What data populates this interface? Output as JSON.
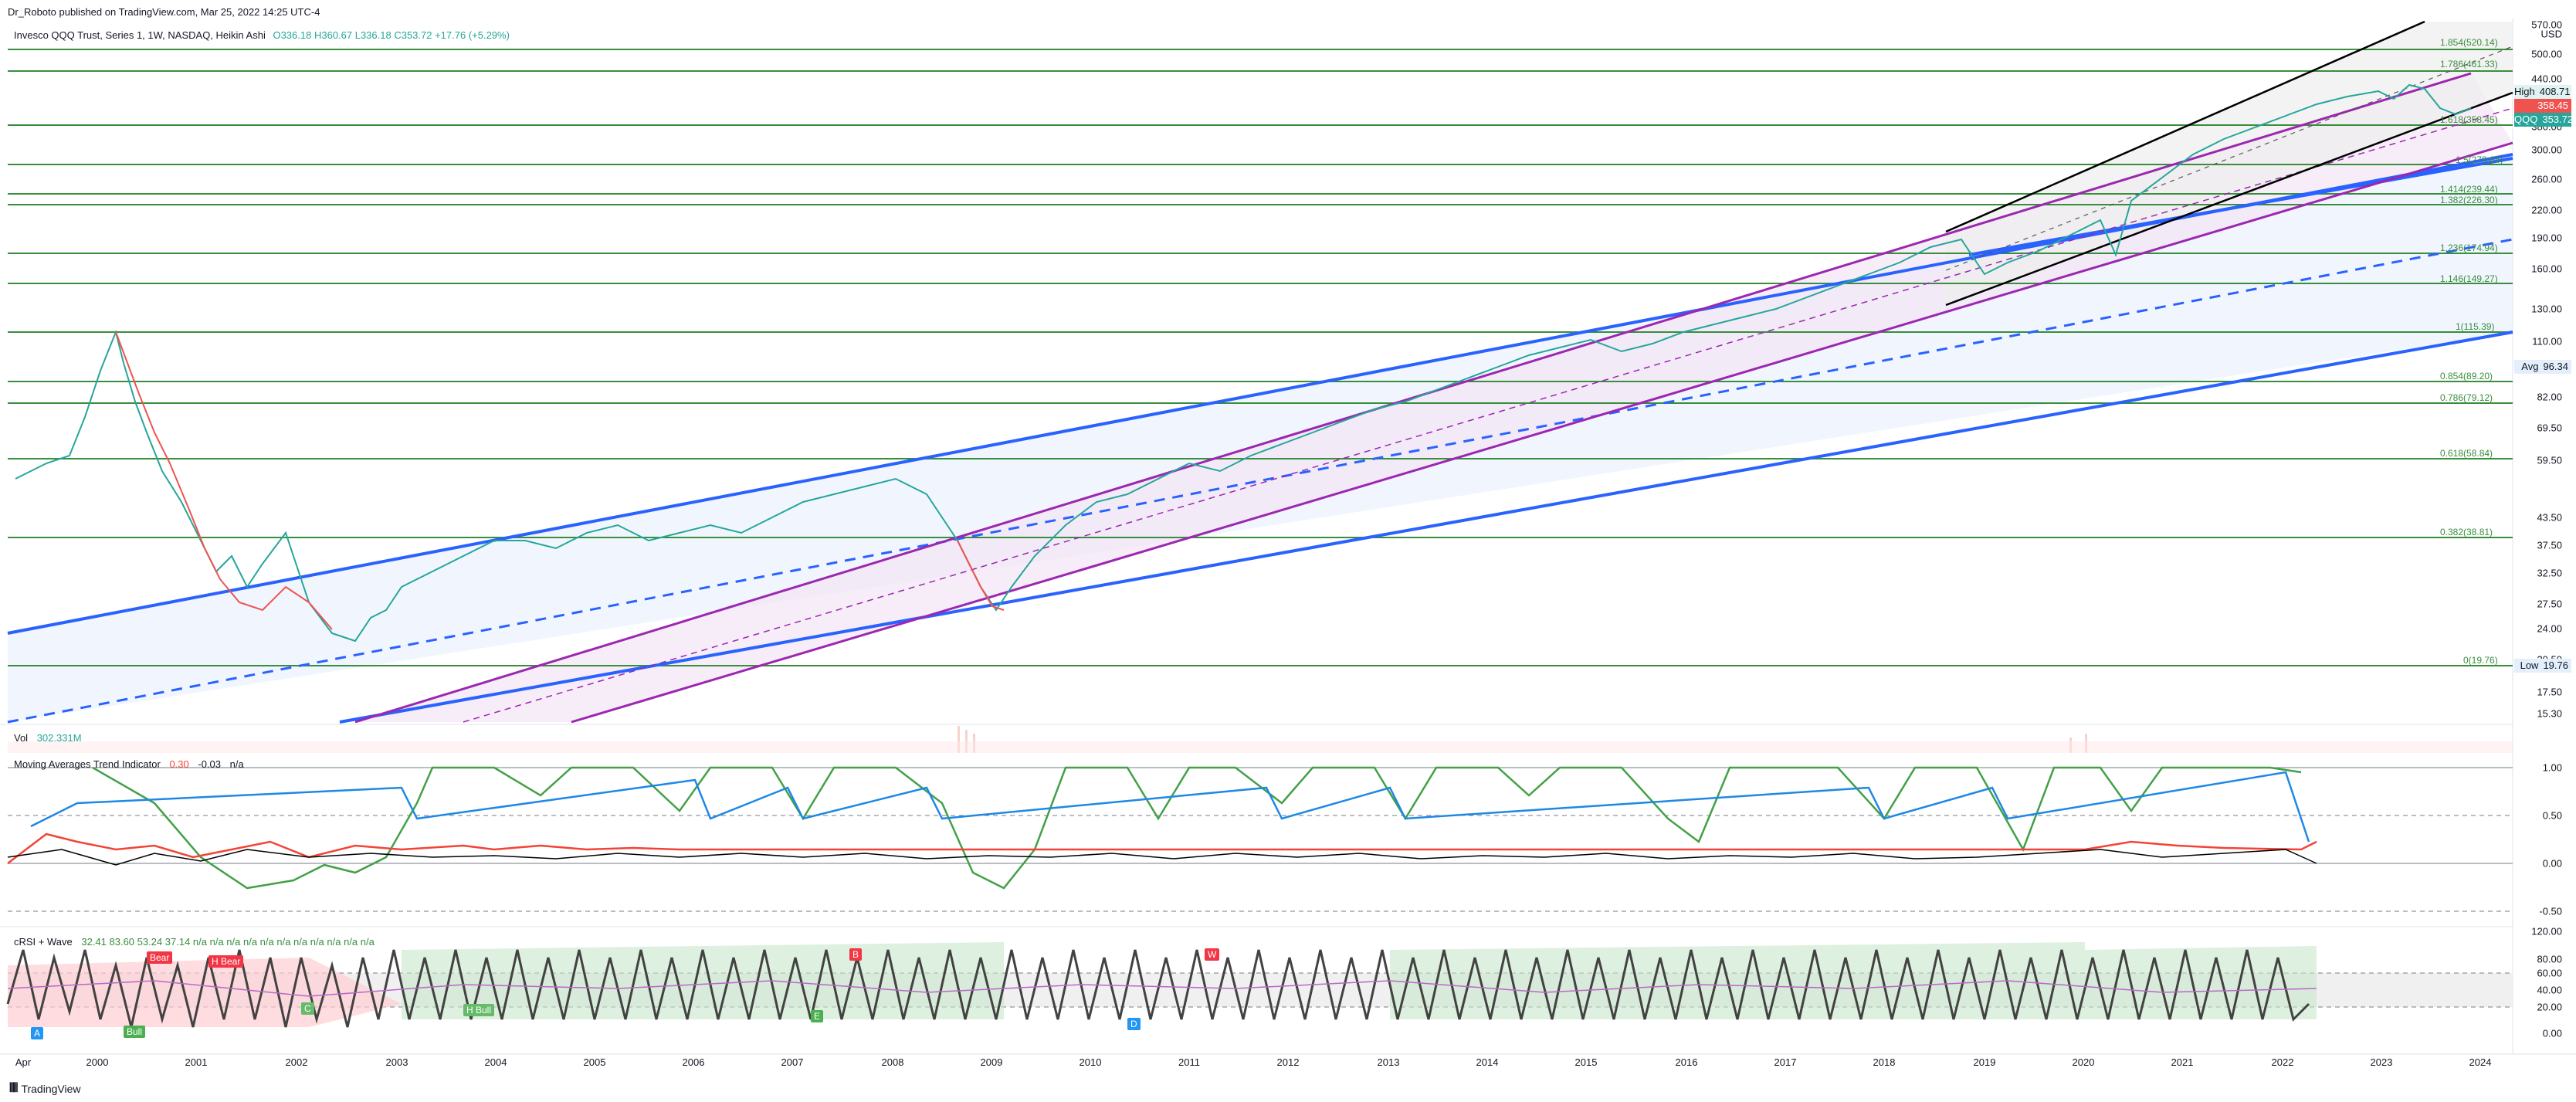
{
  "header": {
    "published": "Dr_Roboto published on TradingView.com, Mar 25, 2022 14:25 UTC-4",
    "symbol_title": "Invesco QQQ Trust, Series 1, 1W, NASDAQ, Heikin Ashi",
    "ohlc": "O336.18 H360.67 L336.18 C353.72 +17.76 (+5.29%)"
  },
  "volume_legend": {
    "label": "Vol",
    "value": "302.331M"
  },
  "mati_legend": {
    "label": "Moving Averages Trend Indicator",
    "v1": "0.30",
    "v2": "-0.03",
    "v3": "n/a"
  },
  "crsi_legend": {
    "label": "cRSI + Wave",
    "values": "32.41  83.60  53.24  37.14  n/a  n/a  n/a  n/a  n/a  n/a  n/a  n/a  n/a  n/a  n/a"
  },
  "price_axis": {
    "currency": "USD",
    "ticks": [
      "570.00",
      "500.00",
      "440.00",
      "380.00",
      "300.00",
      "260.00",
      "220.00",
      "190.00",
      "160.00",
      "130.00",
      "110.00",
      "82.00",
      "69.50",
      "59.50",
      "43.50",
      "37.50",
      "32.50",
      "27.50",
      "24.00",
      "20.50",
      "17.50",
      "15.30"
    ],
    "badges": [
      {
        "label": "High",
        "value": "408.71",
        "color": "#e0f2f1",
        "text_color": "#131722"
      },
      {
        "label": "",
        "value": "358.45",
        "color": "#ef5350",
        "text_color": "#ffffff"
      },
      {
        "label": "QQQ",
        "value": "353.72",
        "color": "#26a69a",
        "text_color": "#ffffff"
      },
      {
        "label": "Avg",
        "value": "96.34",
        "color": "#e3effd",
        "text_color": "#131722"
      },
      {
        "label": "Low",
        "value": "19.76",
        "color": "#e3effd",
        "text_color": "#131722"
      }
    ]
  },
  "mati_axis": [
    "1.00",
    "0.50",
    "0.00",
    "-0.50"
  ],
  "crsi_axis": [
    "120.00",
    "80.00",
    "60.00",
    "40.00",
    "20.00",
    "0.00"
  ],
  "time_axis": [
    "Apr",
    "2000",
    "2001",
    "2002",
    "2003",
    "2004",
    "2005",
    "2006",
    "2007",
    "2008",
    "2009",
    "2010",
    "2011",
    "2012",
    "2013",
    "2014",
    "2015",
    "2016",
    "2017",
    "2018",
    "2019",
    "2020",
    "2021",
    "2022",
    "2023",
    "2024"
  ],
  "fib_levels": [
    "1.854(520.14)",
    "1.786(461.33)",
    "1.618(358.45)",
    "1.5(279.64)",
    "1.414(239.44)",
    "1.382(226.30)",
    "1.236(174.94)",
    "1.146(149.27)",
    "1(115.39)",
    "0.854(89.20)",
    "0.786(79.12)",
    "0.618(58.84)",
    "0.382(38.81)",
    "0(19.76)"
  ],
  "signals": [
    "Bear",
    "Bull",
    "H Bull",
    "A",
    "H Bear",
    "E",
    "C",
    "B",
    "D",
    "W"
  ],
  "footer": {
    "brand": "TradingView"
  },
  "colors": {
    "fib_line": "#388e3c",
    "blue_channel": "#2962ff",
    "purple_channel": "#9c27b0",
    "black_channel": "#000000",
    "candle_up": "#26a69a",
    "candle_down": "#ef5350",
    "mati_green": "#43a047",
    "mati_blue": "#1e88e5",
    "mati_red": "#f44336"
  }
}
